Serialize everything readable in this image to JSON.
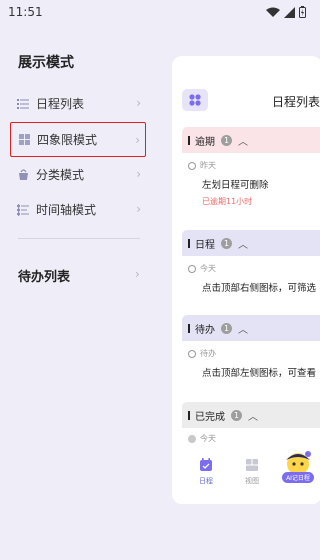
{
  "status_bar": {
    "time": "11:51"
  },
  "sidebar": {
    "section_title": "展示模式",
    "items": [
      {
        "label": "日程列表",
        "icon": "list-icon",
        "selected": false
      },
      {
        "label": "四象限模式",
        "icon": "grid-icon",
        "selected": true
      },
      {
        "label": "分类模式",
        "icon": "bag-icon",
        "selected": false
      },
      {
        "label": "时间轴模式",
        "icon": "timeline-icon",
        "selected": false
      }
    ],
    "todo_title": "待办列表"
  },
  "preview": {
    "title": "日程列表",
    "groups": [
      {
        "name": "逾期",
        "count": "1",
        "color": "#fbe4e8",
        "when": "昨天",
        "task": "左划日程可删除",
        "note": "已逾期11小时"
      },
      {
        "name": "日程",
        "count": "1",
        "color": "#e4e3f6",
        "when": "今天",
        "task": "点击顶部右侧图标，可筛选"
      },
      {
        "name": "待办",
        "count": "1",
        "color": "#e4e3f6",
        "when": "待办",
        "task": "点击顶部左侧图标，可查看"
      },
      {
        "name": "已完成",
        "count": "1",
        "color": "#ececec",
        "when": "今天",
        "task": ""
      }
    ],
    "nav": [
      {
        "label": "日程",
        "icon": "calendar-icon",
        "active": true
      },
      {
        "label": "视图",
        "icon": "view-icon",
        "active": false
      }
    ],
    "ai_label": "AI记日程"
  },
  "colors": {
    "accent": "#6a6ad8",
    "overdue": "#f06a6a",
    "highlight_box": "#e02020"
  }
}
